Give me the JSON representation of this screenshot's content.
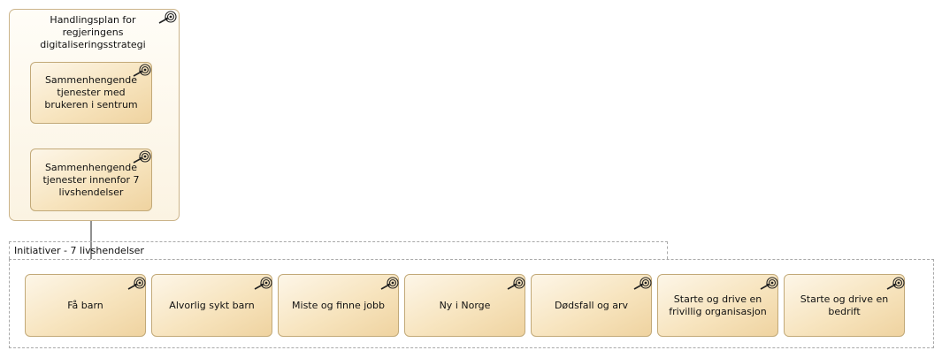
{
  "plan_group": {
    "title": "Handlingsplan for regjeringens digitaliseringsstrategi",
    "goal_top": "Sammenhengende tjenester med brukeren i sentrum",
    "goal_bottom": "Sammenhengende tjenester innenfor 7 livshendelser"
  },
  "initiatives": {
    "label": "Initiativer - 7 livshendelser",
    "items": [
      "Få barn",
      "Alvorlig sykt barn",
      "Miste og finne jobb",
      "Ny i Norge",
      "Dødsfall og arv",
      "Starte og drive en frivillig organisasjon",
      "Starte og drive en bedrift"
    ]
  },
  "colors": {
    "box_fill": "#f7e4be",
    "box_border": "#c2a978",
    "dashed_border": "#a9a9a9"
  },
  "icons": {
    "goal": "goal-target-icon"
  }
}
